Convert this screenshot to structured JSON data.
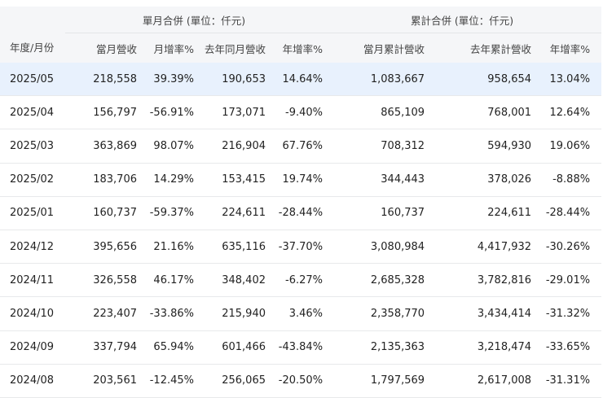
{
  "header": {
    "period_label": "年度/月份",
    "group_monthly": "單月合併 (單位：仟元)",
    "group_cumulative": "累計合併 (單位：仟元)",
    "columns": [
      "當月營收",
      "月增率%",
      "去年同月營收",
      "年增率%",
      "當月累計營收",
      "去年累計營收",
      "年增率%"
    ]
  },
  "rows": [
    [
      "2025/05",
      "218,558",
      "39.39%",
      "190,653",
      "14.64%",
      "1,083,667",
      "958,654",
      "13.04%"
    ],
    [
      "2025/04",
      "156,797",
      "-56.91%",
      "173,071",
      "-9.40%",
      "865,109",
      "768,001",
      "12.64%"
    ],
    [
      "2025/03",
      "363,869",
      "98.07%",
      "216,904",
      "67.76%",
      "708,312",
      "594,930",
      "19.06%"
    ],
    [
      "2025/02",
      "183,706",
      "14.29%",
      "153,415",
      "19.74%",
      "344,443",
      "378,026",
      "-8.88%"
    ],
    [
      "2025/01",
      "160,737",
      "-59.37%",
      "224,611",
      "-28.44%",
      "160,737",
      "224,611",
      "-28.44%"
    ],
    [
      "2024/12",
      "395,656",
      "21.16%",
      "635,116",
      "-37.70%",
      "3,080,984",
      "4,417,932",
      "-30.26%"
    ],
    [
      "2024/11",
      "326,558",
      "46.17%",
      "348,402",
      "-6.27%",
      "2,685,328",
      "3,782,816",
      "-29.01%"
    ],
    [
      "2024/10",
      "223,407",
      "-33.86%",
      "215,940",
      "3.46%",
      "2,358,770",
      "3,434,414",
      "-31.32%"
    ],
    [
      "2024/09",
      "337,794",
      "65.94%",
      "601,466",
      "-43.84%",
      "2,135,363",
      "3,218,474",
      "-33.65%"
    ],
    [
      "2024/08",
      "203,561",
      "-12.45%",
      "256,065",
      "-20.50%",
      "1,797,569",
      "2,617,008",
      "-31.31%"
    ]
  ]
}
